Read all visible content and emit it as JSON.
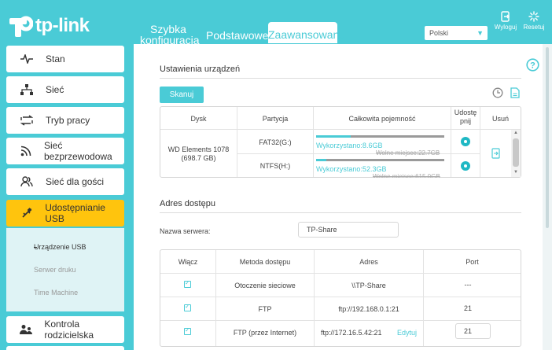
{
  "header": {
    "brand": "tp-link",
    "tabs": [
      {
        "line1": "Szybka",
        "line2": "konfiguracja"
      },
      {
        "label": "Podstawowe"
      },
      {
        "label": "Zaawansowane"
      }
    ],
    "language": "Polski",
    "logout_label": "Wyloguj",
    "reboot_label": "Resetuj"
  },
  "sidebar": {
    "items": [
      {
        "label": "Stan",
        "icon": "pulse-icon"
      },
      {
        "label": "Sieć",
        "icon": "network-icon"
      },
      {
        "label": "Tryb pracy",
        "icon": "mode-arrows-icon"
      },
      {
        "label": "Sieć bezprzewodowa",
        "icon": "wifi-icon"
      },
      {
        "label": "Sieć dla gości",
        "icon": "guests-icon"
      },
      {
        "label": "Udostępnianie USB",
        "icon": "usb-icon"
      },
      {
        "label": "Kontrola rodzicielska",
        "icon": "parental-icon"
      }
    ],
    "sub_items": [
      "Urządzenie USB",
      "Serwer druku",
      "Time Machine"
    ]
  },
  "devices": {
    "title": "Ustawienia urządzeń",
    "scan_label": "Skanuj",
    "columns": [
      "Dysk",
      "Partycja",
      "Całkowita pojemność",
      "Udostę\npnij",
      "Usuń"
    ],
    "disk_name": "WD Elements 1078",
    "disk_size": "(698.7 GB)",
    "partitions": [
      {
        "name": "FAT32(G:)",
        "used": "Wykorzystano:8.6GB",
        "free": "Wolne miejsce:22.7GB",
        "used_fraction": 0.27
      },
      {
        "name": "NTFS(H:)",
        "used": "Wykorzystano:52.3GB",
        "free": "Wolne miejsce:615.0GB",
        "used_fraction": 0.08
      }
    ]
  },
  "access": {
    "title": "Adres dostępu",
    "server_label": "Nazwa serwera:",
    "server_value": "TP-Share",
    "columns": [
      "Włącz",
      "Metoda dostępu",
      "Adres",
      "Port"
    ],
    "rows": [
      {
        "method": "Otoczenie sieciowe",
        "address": "\\\\TP-Share",
        "port": "---"
      },
      {
        "method": "FTP",
        "address": "ftp://192.168.0.1:21",
        "port": "21"
      },
      {
        "method": "FTP (przez Internet)",
        "address": "ftp://172.16.5.42:21",
        "edit": "Edytuj",
        "port": "21"
      }
    ]
  },
  "colors": {
    "accent": "#4acbd6",
    "active_menu": "#ffc40d"
  }
}
